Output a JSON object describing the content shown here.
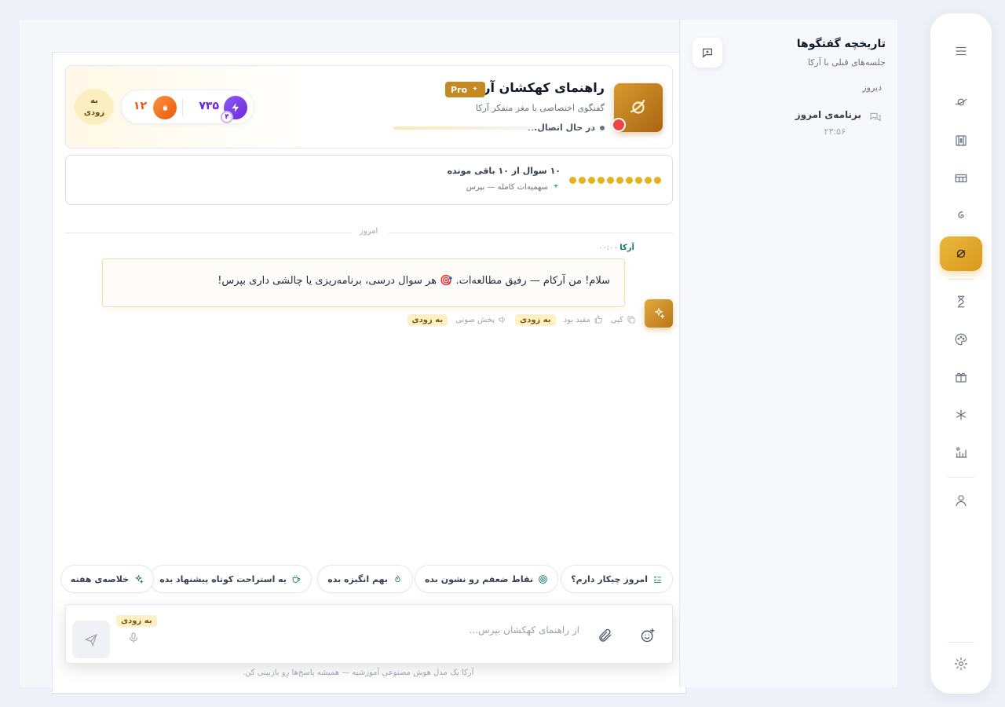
{
  "history": {
    "title": "تاریخچه گفتگوها",
    "subtitle": "جلسه‌های قبلی با آرکا",
    "group_label": "دیروز",
    "items": [
      {
        "title": "برنامه‌ی امروز",
        "time": "۲۳:۵۶"
      }
    ]
  },
  "header": {
    "title": "راهنمای کهکشان آرکا",
    "pro_label": "Pro",
    "subtitle": "گفتگوی اختصاصی با مغز متفکر آرکا",
    "status": "در حال اتصال...",
    "xp_value": "۷۳۵",
    "xp_level": "۴",
    "streak_value": "۱۲",
    "soon_label": "به زودی"
  },
  "quota": {
    "title": "۱۰ سوال از ۱۰ باقی مونده",
    "subtitle": "سهمیه‌ات کامله — بپرس",
    "remaining": 10,
    "total": 10,
    "dot_color": "#e3b41a"
  },
  "chat": {
    "day_label": "امروز",
    "messages": [
      {
        "author": "آرکا",
        "time": "۰۰:۰۰",
        "text": "سلام! من آرکام — رفیق مطالعه‌ات. 🎯 هر سوال درسی، برنامه‌ریزی یا چالشی داری بپرس!"
      }
    ],
    "actions": {
      "copy": "کپی",
      "helpful": "مفید بود",
      "soon1": "به زودی",
      "audio": "پخش صوتی",
      "soon2": "به زودی"
    }
  },
  "suggestions": [
    {
      "label": "امروز چیکار دارم؟",
      "icon": "checklist-icon"
    },
    {
      "label": "نقاط ضعفم رو نشون بده",
      "icon": "target-icon"
    },
    {
      "label": "بهم انگیزه بده",
      "icon": "flame-icon"
    },
    {
      "label": "یه استراحت کوتاه پیشنهاد بده",
      "icon": "coffee-icon"
    },
    {
      "label": "خلاصه‌ی هفته",
      "icon": "sparkles-icon"
    }
  ],
  "composer": {
    "placeholder": "از راهنمای کهکشان بپرس...",
    "mic_soon": "به زودی",
    "disclaimer": "آرکا یک مدل هوش مصنوعی آموزشیه — همیشه پاسخ‌ها رو بازبینی کن."
  },
  "colors": {
    "accent": "#d99a1d",
    "teal": "#0f766e",
    "streak": "#ea580c",
    "xp": "#6d28d9"
  }
}
